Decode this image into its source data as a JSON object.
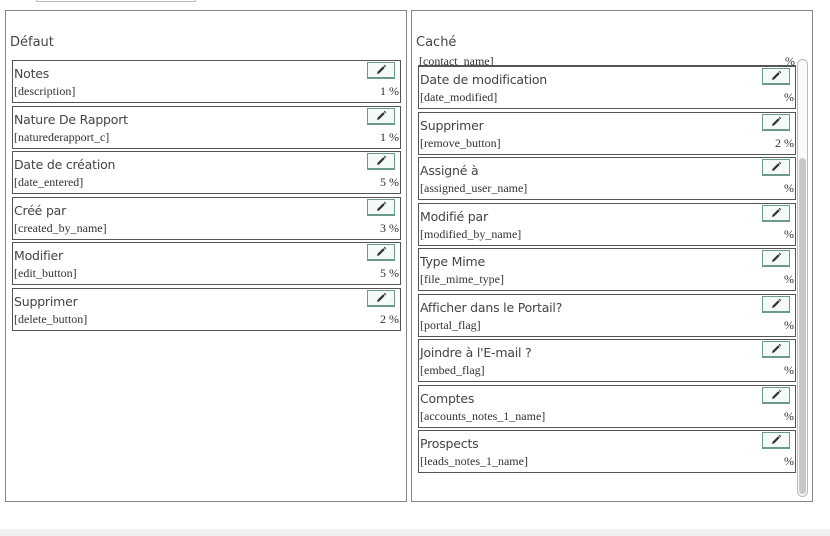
{
  "default_panel": {
    "title": "Défaut",
    "fields": [
      {
        "label": "Notes",
        "name": "[description]",
        "pct": "1 %"
      },
      {
        "label": "Nature De Rapport",
        "name": "[naturederapport_c]",
        "pct": "1 %"
      },
      {
        "label": "Date de création",
        "name": "[date_entered]",
        "pct": "5 %"
      },
      {
        "label": "Créé par",
        "name": "[created_by_name]",
        "pct": "3 %"
      },
      {
        "label": "Modifier",
        "name": "[edit_button]",
        "pct": "5 %"
      },
      {
        "label": "Supprimer",
        "name": "[delete_button]",
        "pct": "2 %"
      }
    ]
  },
  "hidden_panel": {
    "title": "Caché",
    "partial": {
      "name": "[contact_name]",
      "pct": "%"
    },
    "fields": [
      {
        "label": "Date de modification",
        "name": "[date_modified]",
        "pct": "%"
      },
      {
        "label": "Supprimer",
        "name": "[remove_button]",
        "pct": "2 %"
      },
      {
        "label": "Assigné à",
        "name": "[assigned_user_name]",
        "pct": "%"
      },
      {
        "label": "Modifié par",
        "name": "[modified_by_name]",
        "pct": "%"
      },
      {
        "label": "Type Mime",
        "name": "[file_mime_type]",
        "pct": "%"
      },
      {
        "label": "Afficher dans le Portail?",
        "name": "[portal_flag]",
        "pct": "%"
      },
      {
        "label": "Joindre à l'E-mail ?",
        "name": "[embed_flag]",
        "pct": "%"
      },
      {
        "label": "Comptes",
        "name": "[accounts_notes_1_name]",
        "pct": "%"
      },
      {
        "label": "Prospects",
        "name": "[leads_notes_1_name]",
        "pct": "%"
      }
    ]
  },
  "icons": {
    "edit": "pencil-icon"
  },
  "colors": {
    "button_border": "#6b9a86",
    "field_border": "#555555"
  }
}
